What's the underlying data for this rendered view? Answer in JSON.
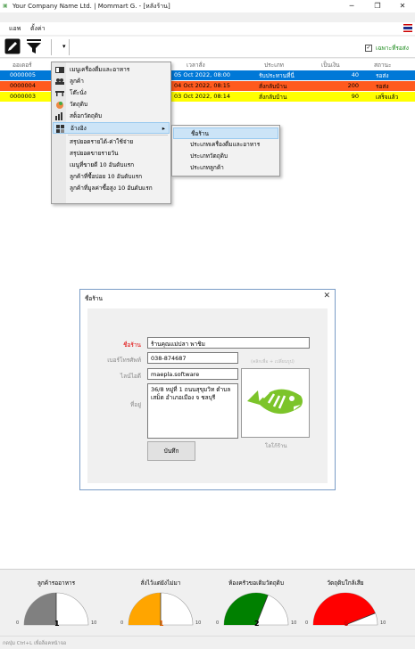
{
  "window": {
    "title": "Your Company Name Ltd. | Mommart G. - [หลังร้าน]",
    "minimize": "─",
    "maximize": "❐",
    "close": "✕"
  },
  "menubar": {
    "items": [
      "แอพ",
      "ตั้งค่า"
    ]
  },
  "toolbar": {
    "dropdown_arrow": "▾",
    "pending_only_label": "เฉพาะที่รอส่ง",
    "pending_only_checked": true
  },
  "grid": {
    "columns": [
      "ออเดอร์",
      "เวลาสั่ง",
      "ประเภท",
      "เป็นเงิน",
      "สถานะ"
    ],
    "rows": [
      {
        "order": "0000005",
        "time": "05 Oct 2022, 08:00",
        "type": "รับประทานที่นี่",
        "amount": "40",
        "status": "รอส่ง",
        "bg": "#0078d7",
        "fg": "#ffffff"
      },
      {
        "order": "0000004",
        "time": "04 Oct 2022, 08:15",
        "type": "สั่งกลับบ้าน",
        "amount": "200",
        "status": "รอส่ง",
        "bg": "#ff5a1e",
        "fg": "#000000"
      },
      {
        "order": "0000003",
        "time": "03 Oct 2022, 08:14",
        "type": "สั่งกลับบ้าน",
        "amount": "90",
        "status": "เสร็จแล้ว",
        "bg": "#ffff00",
        "fg": "#000000"
      }
    ]
  },
  "context_menu": {
    "items": [
      {
        "label": "เมนูเครื่องดื่มและอาหาร",
        "icon": "menu-book-icon"
      },
      {
        "label": "ลูกค้า",
        "icon": "customers-icon"
      },
      {
        "label": "โต๊ะนั่ง",
        "icon": "table-icon"
      },
      {
        "label": "วัตถุดิบ",
        "icon": "ingredient-icon"
      },
      {
        "label": "สต็อกวัตถุดิบ",
        "icon": "stock-icon"
      },
      {
        "label": "อ้างอิง",
        "icon": "reference-icon",
        "submenu_arrow": "▸"
      },
      {
        "label": "สรุปยอดรายได้-ค่าใช้จ่าย"
      },
      {
        "label": "สรุปยอดขายรายวัน"
      },
      {
        "label": "เมนูที่ขายดี 10 อันดับแรก"
      },
      {
        "label": "ลูกค้าที่ซื้อบ่อย 10 อันดับแรก"
      },
      {
        "label": "ลูกค้าที่มูลค่าซื้อสูง 10 อันดับแรก"
      }
    ]
  },
  "submenu": {
    "items": [
      "ชื่อร้าน",
      "ประเภทเครื่องดื่มและอาหาร",
      "ประเภทวัตถุดิบ",
      "ประเภทลูกค้า"
    ]
  },
  "dialog": {
    "title": "ชื่อร้าน",
    "close": "✕",
    "shop_name_label": "ชื่อร้าน",
    "shop_name": "ร้านคุณแม่ปลา พาชิม",
    "phone_label": "เบอร์โทรศัพท์",
    "phone": "038-874687",
    "lineid_label": "ไลน์ไอดี",
    "lineid": "maepla.software",
    "address_label": "ที่อยู่",
    "address": "36/8 หมู่ที่ 1 ถนนสุขุมวิท ตำบลเสม็ด อำเภอเมือง จ ชลบุรี",
    "logo_hint": "(คลิกเพื่อ + เปลี่ยนรูป)",
    "logo_caption": "โลโก้ร้าน",
    "save_button": "บันทึก"
  },
  "gauges": [
    {
      "title": "ลูกค้ารออาหาร",
      "value": "1",
      "min": "0",
      "max": "10",
      "color": "#808080",
      "fraction": 0.5
    },
    {
      "title": "สั่งไว้แต่ยังไม่มา",
      "value": "1",
      "min": "0",
      "max": "10",
      "color": "#ffa500",
      "fraction": 0.5
    },
    {
      "title": "ห้องครัวขอเติมวัตถุดิบ",
      "value": "2",
      "min": "0",
      "max": "10",
      "color": "#008000",
      "fraction": 0.62
    },
    {
      "title": "วัตถุดิบใกล้เสีย",
      "value": "6",
      "min": "0",
      "max": "10",
      "color": "#ff0000",
      "fraction": 0.88
    }
  ],
  "statusbar": {
    "text": "กดปุ่ม Ctrl+L เพื่อล็อคหน้าจอ"
  }
}
